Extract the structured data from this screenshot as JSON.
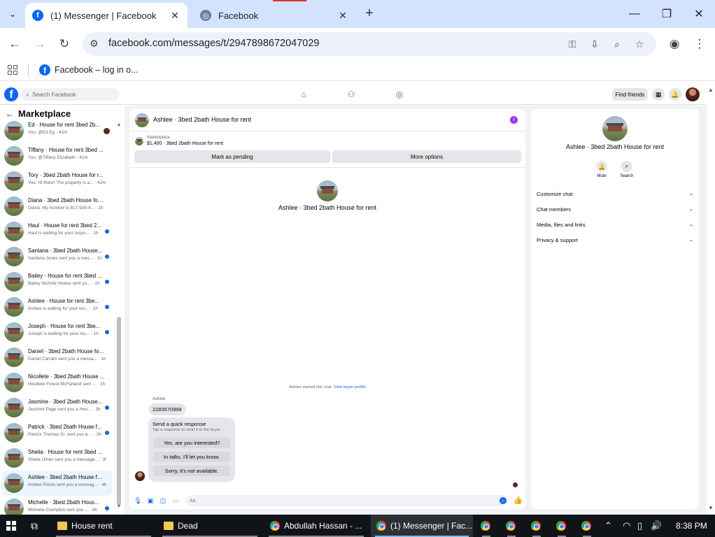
{
  "browser": {
    "tabs": [
      {
        "title": "(1) Messenger | Facebook",
        "active": true
      },
      {
        "title": "Facebook",
        "active": false
      }
    ],
    "url": "facebook.com/messages/t/2947898672047029",
    "bookmark": "Facebook – log in o..."
  },
  "fb": {
    "search_placeholder": "Search Facebook",
    "find_friends": "Find friends"
  },
  "sidebar": {
    "title": "Marketplace",
    "conversations": [
      {
        "name": "Ed · House for rent 3bed 2b...",
        "preview": "You: @Ed Eg · 41m",
        "unread": false,
        "mini": true
      },
      {
        "name": "Tiffany · House for rent 3bed ...",
        "preview": "You: @Tiffany Elizabeth · 41m",
        "unread": false
      },
      {
        "name": "Tory · 3bed 2bath House for r...",
        "preview": "You: Hi there! The property is a... · 42m",
        "unread": false
      },
      {
        "name": "Diana · 3bed 2bath House for ...",
        "preview": "Diana: My number is 817-939-4... · 1h",
        "unread": false
      },
      {
        "name": "Haul · House for rent 3bed 2...",
        "preview": "Haul is waiting for your respo... · 1h",
        "unread": true
      },
      {
        "name": "Santana · 3bed 2bath House...",
        "preview": "Santana Jones sent you a mes... · 1h",
        "unread": true
      },
      {
        "name": "Bailey · House for rent 3bed ...",
        "preview": "Bailey Nichole Howse sent yo... · 1h",
        "unread": true
      },
      {
        "name": "Ashlee · House for rent 3be...",
        "preview": "Ashlee is waiting for your res... · 1h",
        "unread": true
      },
      {
        "name": "Joseph · House for rent 3be...",
        "preview": "Joseph is waiting for your res... · 1h",
        "unread": true
      },
      {
        "name": "Daniel · 3bed 2bath House for...",
        "preview": "Daniel Carraro sent you a messa... · 1h",
        "unread": false
      },
      {
        "name": "Nicollete · 3bed 2bath House ...",
        "preview": "Nicollete Forest McFarland sent ... · 1h",
        "unread": false
      },
      {
        "name": "Jasmine · 3bed 2bath House...",
        "preview": "Jasmine Page sent you a mes... · 3h",
        "unread": true
      },
      {
        "name": "Patrick · 3bed 2bath House f...",
        "preview": "Patrick Thomas Sr. sent you a ... · 3h",
        "unread": true
      },
      {
        "name": "Sheila · House for rent 3bed 2...",
        "preview": "Sheila Ulmer sent you a message... · 3h",
        "unread": false
      },
      {
        "name": "Ashlee · 3bed 2bath House for...",
        "preview": "Ashlee Flores sent you a messag... · 4h",
        "unread": false,
        "selected": true
      },
      {
        "name": "Michelle · 3bed 2bath Hous...",
        "preview": "Michelle Crampton sent you ... · 8h",
        "unread": true
      }
    ]
  },
  "chat": {
    "title": "Ashlee · 3bed 2bath House for rent",
    "marketplace_label": "Marketplace",
    "listing": "$1,400 · 3bed 2bath House for rent",
    "mark_pending": "Mark as pending",
    "more_options": "More options",
    "hero_name": "Ashlee · 3bed 2bath House for rent",
    "started_text": "Ashlee started this chat.",
    "view_profile": "View buyer profile",
    "sender": "Ashlee",
    "phone_message": "2283570999",
    "quick_title": "Send a quick response",
    "quick_sub": "Tap a response to send it to the buyer.",
    "quick_options": [
      "Yes, are you interested?",
      "In talks. I'll let you know.",
      "Sorry, it's not available."
    ],
    "composer_placeholder": "Aa"
  },
  "info_panel": {
    "name": "Ashlee · 3bed 2bath House for rent",
    "actions": [
      {
        "label": "Mute"
      },
      {
        "label": "Search"
      }
    ],
    "sections": [
      "Customize chat",
      "Chat members",
      "Media, files and links",
      "Privacy & support"
    ]
  },
  "taskbar": {
    "items": [
      "House rent",
      "Dead",
      "Abdullah Hassan - ...",
      "(1) Messenger | Fac..."
    ],
    "time": "8:38 PM"
  }
}
